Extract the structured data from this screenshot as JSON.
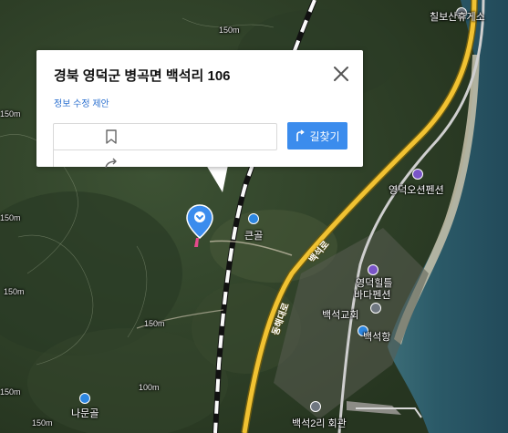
{
  "popup": {
    "title": "경북 영덕군 병곡면 백석리 106",
    "edit_link": "정보 수정 제안",
    "directions_label": "길찾기",
    "bookmark_icon": "bookmark-icon",
    "share_icon": "share-icon",
    "close_icon": "close-icon",
    "directions_icon": "route-icon"
  },
  "map": {
    "places": {
      "rest_area": "칠보산휴게소",
      "pension1": "영덕오션펜션",
      "keungol": "큰골",
      "pension2_line1": "영덕힐틀",
      "pension2_line2": "바다펜션",
      "church": "백석교회",
      "port": "백석항",
      "hall": "백석2리 회관",
      "nakmungol": "나문골"
    },
    "roads": {
      "baekseok_road": "백석로",
      "donghae_road": "동해대로"
    },
    "elevations": {
      "e1": "150m",
      "e2": "150m",
      "e3": "150m",
      "e4": "150m",
      "e5": "150m",
      "e6": "150m",
      "e7": "100m",
      "e8": "150m"
    },
    "colors": {
      "pin": "#3b8ced",
      "highway": "#f1c232",
      "directions_button": "#3b8ced"
    }
  }
}
